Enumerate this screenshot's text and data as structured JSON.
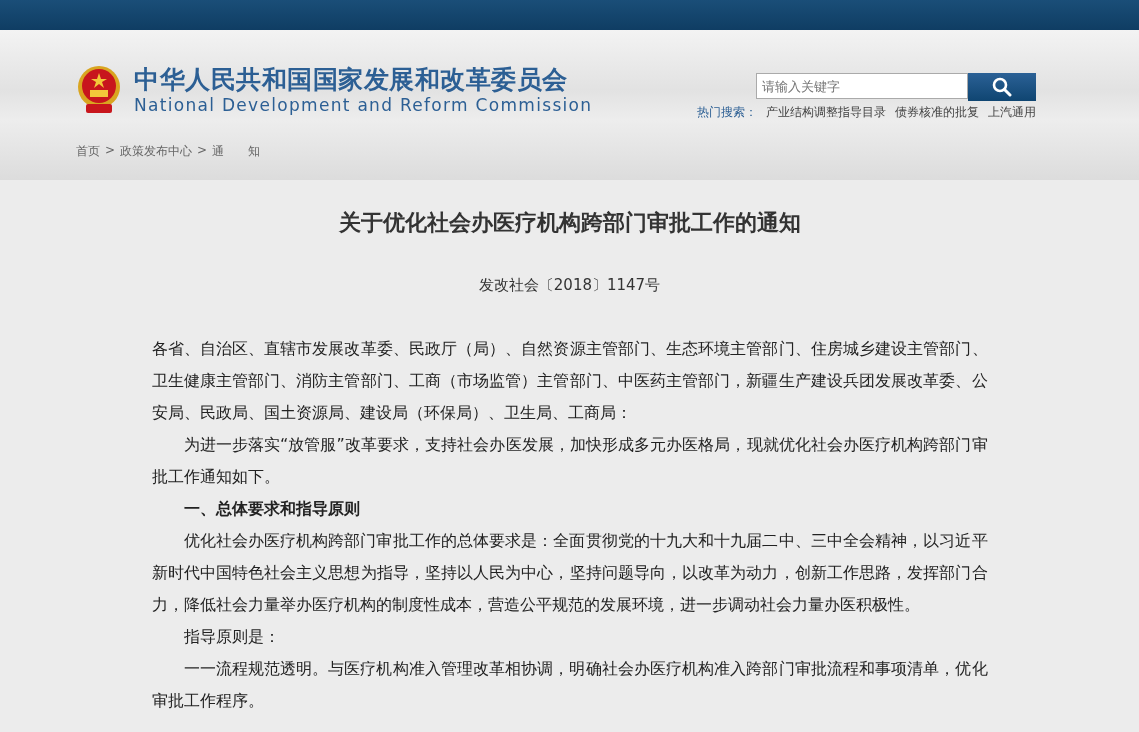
{
  "header": {
    "title_cn": "中华人民共和国国家发展和改革委员会",
    "title_en": "National Development and Reform Commission"
  },
  "search": {
    "placeholder": "请输入关键字",
    "hot_label": "热门搜索：",
    "hot_links": [
      "产业结构调整指导目录",
      "债券核准的批复",
      "上汽通用"
    ]
  },
  "breadcrumb": [
    {
      "label": "首页"
    },
    {
      "label": "政策发布中心"
    },
    {
      "label": "通　　知"
    }
  ],
  "breadcrumb_separator": ">",
  "article": {
    "title": "关于优化社会办医疗机构跨部门审批工作的通知",
    "doc_number": "发改社会〔2018〕1147号",
    "paragraphs": [
      {
        "kind": "plain",
        "text": "各省、自治区、直辖市发展改革委、民政厅（局）、自然资源主管部门、生态环境主管部门、住房城乡建设主管部门、卫生健康主管部门、消防主管部门、工商（市场监管）主管部门、中医药主管部门，新疆生产建设兵团发展改革委、公安局、民政局、国土资源局、建设局（环保局）、卫生局、工商局："
      },
      {
        "kind": "indent",
        "text": "为进一步落实“放管服”改革要求，支持社会办医发展，加快形成多元办医格局，现就优化社会办医疗机构跨部门审批工作通知如下。"
      },
      {
        "kind": "heading",
        "text": "一、总体要求和指导原则"
      },
      {
        "kind": "indent",
        "text": "优化社会办医疗机构跨部门审批工作的总体要求是：全面贯彻党的十九大和十九届二中、三中全会精神，以习近平新时代中国特色社会主义思想为指导，坚持以人民为中心，坚持问题导向，以改革为动力，创新工作思路，发挥部门合力，降低社会力量举办医疗机构的制度性成本，营造公平规范的发展环境，进一步调动社会力量办医积极性。"
      },
      {
        "kind": "indent",
        "text": "指导原则是："
      },
      {
        "kind": "indent",
        "text": "一一流程规范透明。与医疗机构准入管理改革相协调，明确社会办医疗机构准入跨部门审批流程和事项清单，优化审批工作程序。"
      }
    ]
  }
}
